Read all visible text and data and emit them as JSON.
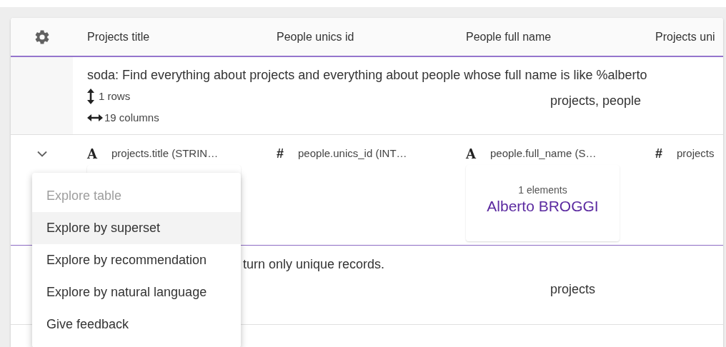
{
  "table": {
    "columns": [
      {
        "label": "Projects title"
      },
      {
        "label": "People unics id"
      },
      {
        "label": "People full name"
      },
      {
        "label": "Projects uni"
      }
    ],
    "rows": [
      {
        "kind": "query",
        "text": "soda: Find everything about projects and everything about people whose full name is like %alberto",
        "rows_count": "1 rows",
        "columns_count": "19 columns",
        "tables": "projects, people"
      },
      {
        "kind": "fields",
        "expanded": false,
        "fields": [
          {
            "kind": "string",
            "icon": "A",
            "name": "projects.title (STRIN…",
            "card": true
          },
          {
            "kind": "number",
            "icon": "#",
            "name": "people.unics_id (INT…",
            "card": false
          },
          {
            "kind": "string",
            "icon": "A",
            "name": "people.full_name (S…",
            "card": true,
            "count": "1 elements",
            "value": "Alberto BROGGI"
          },
          {
            "kind": "number",
            "icon": "#",
            "name": "projects",
            "card": false
          }
        ]
      },
      {
        "kind": "query_tail",
        "text": "turn only unique records.",
        "tables": "projects"
      }
    ]
  },
  "menu": {
    "items": [
      {
        "label": "Explore table",
        "disabled": true,
        "selected": false
      },
      {
        "label": "Explore by superset",
        "disabled": false,
        "selected": true
      },
      {
        "label": "Explore by recommendation",
        "disabled": false,
        "selected": false
      },
      {
        "label": "Explore by natural language",
        "disabled": false,
        "selected": false
      },
      {
        "label": "Give feedback",
        "disabled": false,
        "selected": false
      }
    ]
  }
}
